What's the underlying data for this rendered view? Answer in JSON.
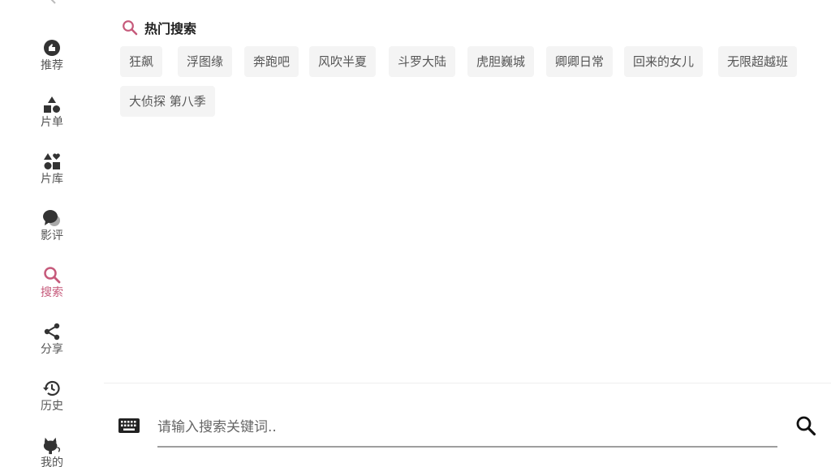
{
  "sidebar": {
    "items": [
      {
        "label": "推荐",
        "icon": "recommend-icon"
      },
      {
        "label": "片单",
        "icon": "playlist-icon"
      },
      {
        "label": "片库",
        "icon": "library-icon"
      },
      {
        "label": "影评",
        "icon": "review-icon"
      },
      {
        "label": "搜索",
        "icon": "search-icon"
      },
      {
        "label": "分享",
        "icon": "share-icon"
      },
      {
        "label": "历史",
        "icon": "history-icon"
      },
      {
        "label": "我的",
        "icon": "profile-icon"
      }
    ],
    "active": "搜索"
  },
  "hot_search": {
    "title": "热门搜索",
    "tags": [
      "狂飙",
      "浮图缘",
      "奔跑吧",
      "风吹半夏",
      "斗罗大陆",
      "虎胆巍城",
      "卿卿日常",
      "回来的女儿",
      "无限超越班",
      "大侦探 第八季"
    ]
  },
  "search": {
    "placeholder": "请输入搜索关键词.."
  },
  "colors": {
    "accent": "#c65a7b",
    "icon": "#333333",
    "tag_bg": "#f4f4f4"
  }
}
